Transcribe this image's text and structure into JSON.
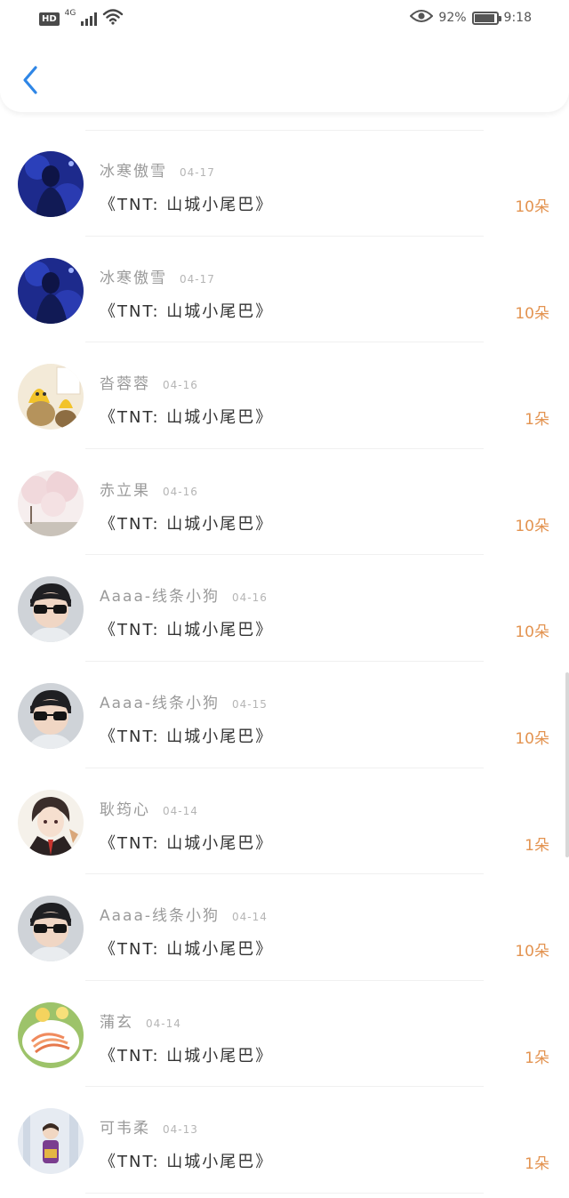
{
  "status_bar": {
    "hd": "HD",
    "network": "4G",
    "battery_percent": "92%",
    "battery_level": 0.92,
    "time": "9:18"
  },
  "icons": {
    "back": "chevron-left-icon",
    "wifi": "wifi-icon",
    "eye": "eye-icon",
    "battery": "battery-icon",
    "signal": "signal-icon"
  },
  "colors": {
    "accent_back": "#2f86e6",
    "count": "#e39350",
    "name": "#9a9a9a",
    "gift": "#333333"
  },
  "records": [
    {
      "name": "冰寒傲雪",
      "date": "04-17",
      "gift": "《TNT: 山城小尾巴》",
      "count": "10朵",
      "avatar": "dark-blue-stage"
    },
    {
      "name": "冰寒傲雪",
      "date": "04-17",
      "gift": "《TNT: 山城小尾巴》",
      "count": "10朵",
      "avatar": "dark-blue-stage"
    },
    {
      "name": "沓蓉蓉",
      "date": "04-16",
      "gift": "《TNT: 山城小尾巴》",
      "count": "1朵",
      "avatar": "yellow-toy"
    },
    {
      "name": "赤立果",
      "date": "04-16",
      "gift": "《TNT: 山城小尾巴》",
      "count": "10朵",
      "avatar": "pink-blossom"
    },
    {
      "name": "Aaaa-线条小狗",
      "date": "04-16",
      "gift": "《TNT: 山城小尾巴》",
      "count": "10朵",
      "avatar": "boy-sunglasses"
    },
    {
      "name": "Aaaa-线条小狗",
      "date": "04-15",
      "gift": "《TNT: 山城小尾巴》",
      "count": "10朵",
      "avatar": "boy-sunglasses"
    },
    {
      "name": "耿筠心",
      "date": "04-14",
      "gift": "《TNT: 山城小尾巴》",
      "count": "1朵",
      "avatar": "anime-character"
    },
    {
      "name": "Aaaa-线条小狗",
      "date": "04-14",
      "gift": "《TNT: 山城小尾巴》",
      "count": "10朵",
      "avatar": "boy-sunglasses"
    },
    {
      "name": "蒲玄",
      "date": "04-14",
      "gift": "《TNT: 山城小尾巴》",
      "count": "1朵",
      "avatar": "food-plate"
    },
    {
      "name": "可韦柔",
      "date": "04-13",
      "gift": "《TNT: 山城小尾巴》",
      "count": "1朵",
      "avatar": "winter-figure"
    }
  ]
}
